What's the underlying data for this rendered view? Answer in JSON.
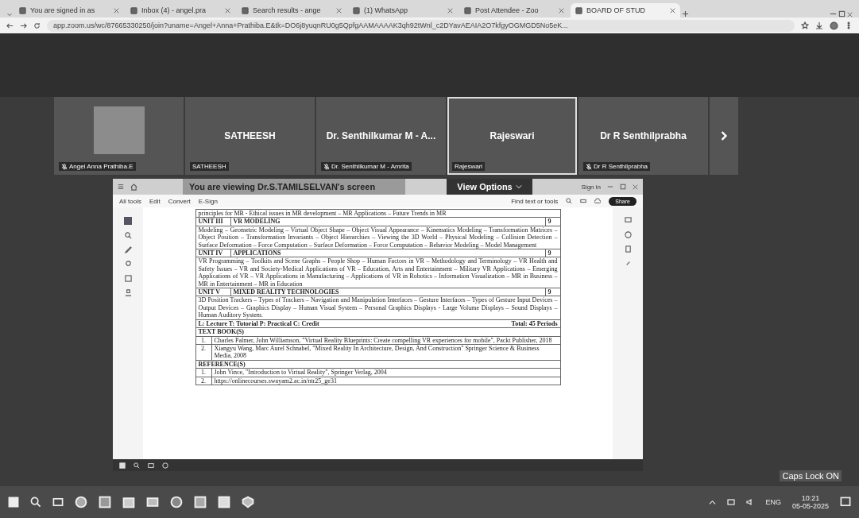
{
  "browser": {
    "tabs": [
      {
        "title": "You are signed in as",
        "selected": false
      },
      {
        "title": "Inbox (4) - angel.pra",
        "selected": false
      },
      {
        "title": "Search results - ange",
        "selected": false
      },
      {
        "title": "(1) WhatsApp",
        "selected": false
      },
      {
        "title": "Post Attendee - Zoo",
        "selected": false
      },
      {
        "title": "BOARD OF STUD",
        "selected": true
      }
    ],
    "address": "app.zoom.us/wc/87665330250/join?uname=Angel+Anna+Prathiba.E&tk=DO6j8yuqnRU0g5QpfgAAMAAAAK3qh92tWnl_c2DYavAEAIA2O7kfgyOGMGD5No5eK..."
  },
  "participants": [
    {
      "kind": "photo",
      "label": "Angel Anna Prathiba.E",
      "muted": true,
      "selected": false
    },
    {
      "kind": "name",
      "name": "SATHEESH",
      "label": "SATHEESH",
      "muted": false,
      "selected": false
    },
    {
      "kind": "name",
      "name": "Dr. Senthilkumar M - A...",
      "label": "Dr. Senthilkumar M - Amrita",
      "muted": true,
      "selected": false
    },
    {
      "kind": "name",
      "name": "Rajeswari",
      "label": "Rajeswari",
      "muted": false,
      "selected": true
    },
    {
      "kind": "name",
      "name": "Dr R Senthilprabha",
      "label": "Dr R Senthilprabha",
      "muted": true,
      "selected": false
    }
  ],
  "share": {
    "banner": "You are viewing",
    "presenter": "Dr.S.TAMILSELVAN",
    "presenter_suffix": "'s screen",
    "view_options": "View Options",
    "sign_in": "Sign in",
    "pdf_menus": [
      "All tools",
      "Edit",
      "Convert",
      "E-Sign"
    ],
    "search_placeholder": "Find text or tools",
    "share_button": "Share",
    "document": {
      "intro": "principles for MR - Ethical issues in MR development – MR Applications – Future Trends in MR",
      "units": [
        {
          "number": "UNIT III",
          "title": "VR MODELING",
          "hours": "9",
          "body": "Modeling – Geometric Modeling – Virtual Object Shape – Object Visual Appearance – Kinematics Modeling – Transformation Matrices – Object Position – Transformation Invariants – Object Hierarchies – Viewing the 3D World – Physical Modeling – Collision Detection – Surface Deformation – Force Computation – Surface Deformation – Force Computation – Behavior Modeling – Model Management"
        },
        {
          "number": "UNIT IV",
          "title": "APPLICATIONS",
          "hours": "9",
          "body": "VR Programming – Toolkits and Scene Graphs – People Shop – Human Factors in VR – Methodology and Terminology – VR Health and Safety Issues – VR and Society-Medical Applications of VR – Education, Arts and Entertainment – Military VR Applications – Emerging Applications of VR – VR Applications in Manufacturing – Applications of VR in Robotics – Information Visualization – MR in Business – MR in Entertainment – MR in Education"
        },
        {
          "number": "UNIT V",
          "title": "MIXED REALITY TECHNOLOGIES",
          "hours": "9",
          "body": "3D Position Trackers – Types of Trackers – Navigation and Manipulation Interfaces – Gesture Interfaces – Types of Gesture Input Devices – Output Devices – Graphics Display – Human Visual System – Personal Graphics Displays - Large Volume Displays – Sound Displays – Human Auditory System."
        }
      ],
      "legend": "L: Lecture  T: Tutorial  P: Practical  C: Credit",
      "total": "Total: 45 Periods",
      "textbooks_heading": "TEXT BOOK(S)",
      "textbooks": [
        {
          "index": "1.",
          "text": "Charles Palmer, John Williamson, \"Virtual Reality Blueprints: Create compelling VR experiences for mobile\", Packt Publisher, 2018"
        },
        {
          "index": "2.",
          "text": "Xiangyu Wang, Marc Aurel Schnabel, \"Mixed Reality In Architecture, Design, And Construction\" Springer Science & Business Media, 2008"
        }
      ],
      "references_heading": "REFERENCE(S)",
      "references": [
        {
          "index": "1.",
          "text": "John Vince, \"Introduction to Virtual Reality\", Springer Verlag, 2004"
        },
        {
          "index": "2.",
          "text": "https://onlinecourses.swayam2.ac.in/ntr25_ge31"
        }
      ]
    }
  },
  "caps_lock": "Caps Lock ON",
  "taskbar": {
    "language": "ENG",
    "time": "10:21",
    "date": "05-05-2025"
  }
}
